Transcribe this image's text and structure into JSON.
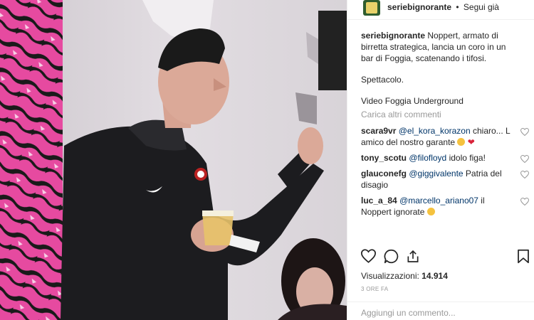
{
  "header": {
    "username": "seriebignorante",
    "separator": "•",
    "follow_status": "Segui già"
  },
  "caption": {
    "username": "seriebignorante",
    "text": "Noppert, armato di birretta strategica, lancia un coro in un bar di Foggia, scatenando i tifosi.",
    "line2": "Spettacolo.",
    "line3": "Video Foggia Underground"
  },
  "load_more": "Carica altri commenti",
  "comments": [
    {
      "user": "scara9vr",
      "mention": "@el_kora_korazon",
      "text": " chiaro... L amico del nostro garante"
    },
    {
      "user": "tony_scotu",
      "mention": "@filofloyd",
      "text": " idolo figa!"
    },
    {
      "user": "glauconefg",
      "mention": "@giggivalente",
      "text": " Patria del disagio"
    },
    {
      "user": "luc_a_84",
      "mention": "@marcello_ariano07",
      "text": " il Noppert ignorate"
    }
  ],
  "stats": {
    "views_label": "Visualizzazioni:",
    "views_value": "14.914",
    "time_ago": "3 ORE FA"
  },
  "add_comment_placeholder": "Aggiungi un commento...",
  "icons": [
    "like-icon",
    "comment-icon",
    "share-icon",
    "bookmark-icon",
    "heart-small-icon"
  ],
  "colors": {
    "text": "#262626",
    "muted": "#999999",
    "mention": "#003569",
    "border": "#efefef"
  }
}
